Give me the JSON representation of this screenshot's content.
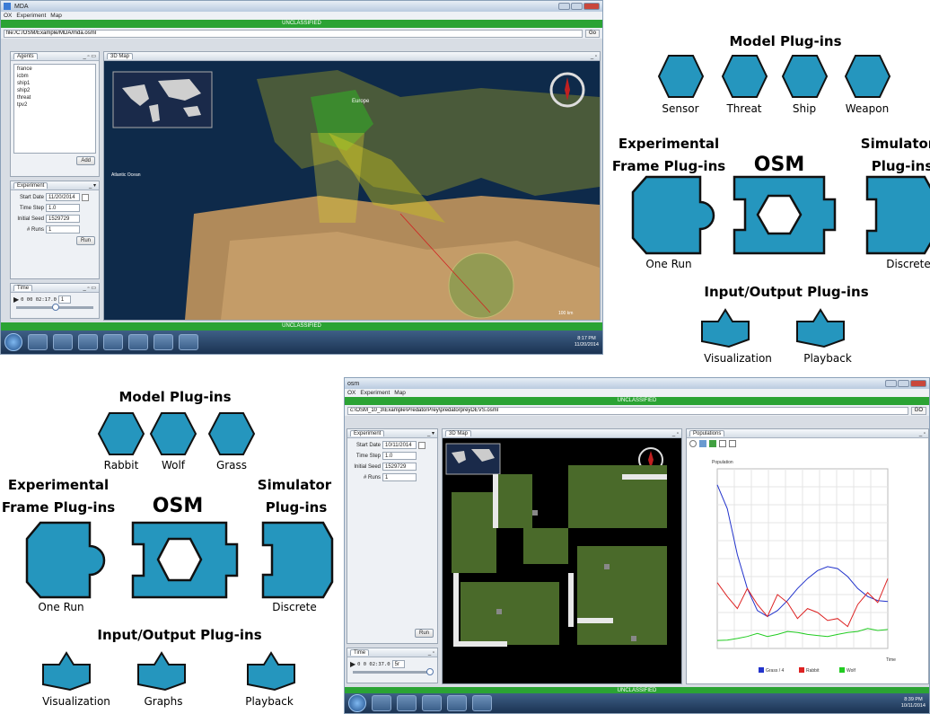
{
  "topleft_window": {
    "app_title": "MDA",
    "menu": [
      "OX",
      "Experiment",
      "Map"
    ],
    "banner_top": "UNCLASSIFIED",
    "banner_bottom": "UNCLASSIFIED",
    "url": "file:/C:/OSM/Example/MDA/mda.osml",
    "go_label": "Go",
    "agents_tab": "Agents",
    "agents": [
      "france",
      "icbm",
      "ship1",
      "ship2",
      "threat",
      "tpv2"
    ],
    "add_label": "Add",
    "experiment_tab": "Experiment",
    "start_date_label": "Start Date",
    "start_date": "11/20/2014",
    "time_step_label": "Time Step",
    "time_step": "1.0",
    "initial_seed_label": "Initial Seed",
    "initial_seed": "1529729",
    "runs_label": "# Runs",
    "runs": "1",
    "run_label": "Run",
    "time_tab": "Time",
    "time_value": "0 00 02:17.0",
    "time_speed": "1",
    "map_tab": "3D Map",
    "map_labels": {
      "europe": "Europe",
      "atlantic": "Atlantic Ocean",
      "scale": "100 km"
    },
    "clock_time": "8:17 PM",
    "clock_date": "11/20/2014"
  },
  "diagram_top": {
    "model_title": "Model Plug-ins",
    "model_plugins": [
      "Sensor",
      "Threat",
      "Ship",
      "Weapon"
    ],
    "ef_title_line1": "Experimental",
    "ef_title_line2": "Frame Plug-ins",
    "osm_title": "OSM",
    "sim_title_line1": "Simulator",
    "sim_title_line2": "Plug-ins",
    "ef_plugin": "One Run",
    "sim_plugin": "Discrete",
    "io_title": "Input/Output Plug-ins",
    "io_plugins": [
      "Visualization",
      "Playback"
    ]
  },
  "diagram_bottom": {
    "model_title": "Model Plug-ins",
    "model_plugins": [
      "Rabbit",
      "Wolf",
      "Grass"
    ],
    "ef_title_line1": "Experimental",
    "ef_title_line2": "Frame Plug-ins",
    "osm_title": "OSM",
    "sim_title_line1": "Simulator",
    "sim_title_line2": "Plug-ins",
    "ef_plugin": "One Run",
    "sim_plugin": "Discrete",
    "io_title": "Input/Output Plug-ins",
    "io_plugins": [
      "Visualization",
      "Graphs",
      "Playback"
    ]
  },
  "bottomright_window": {
    "app_title": "osm",
    "menu": [
      "OX",
      "Experiment",
      "Map"
    ],
    "banner_top": "UNCLASSIFIED",
    "banner_bottom": "UNCLASSIFIED",
    "url": "c:\\OSM_10_3\\Example\\PredatorPrey\\predatorpreyDEVS.osml",
    "go_label": "GO",
    "experiment_tab": "Experiment",
    "start_date_label": "Start Date",
    "start_date": "10/11/2014",
    "time_step_label": "Time Step",
    "time_step": "1.0",
    "initial_seed_label": "Initial Seed",
    "initial_seed": "1529729",
    "runs_label": "# Runs",
    "runs": "1",
    "run_label": "Run",
    "time_tab": "Time",
    "time_value": "0 0 02:37.0",
    "time_speed": "5r",
    "map_tab": "3D Map",
    "populations_tab": "Populations",
    "chart_ylabel": "Population",
    "chart_xlabel": "Time",
    "clock_time": "8:39 PM",
    "clock_date": "10/11/2014"
  },
  "chart_data": {
    "type": "line",
    "title": "",
    "ylabel": "Population",
    "xlabel": "Time",
    "legend": [
      "Grass / 4",
      "Rabbit",
      "Wolf"
    ],
    "colors": [
      "#2233cc",
      "#dd2222",
      "#22cc22"
    ],
    "series": [
      {
        "name": "Grass / 4",
        "values": [
          820,
          700,
          470,
          300,
          190,
          160,
          190,
          240,
          300,
          350,
          390,
          410,
          400,
          360,
          300,
          260,
          240,
          235
        ]
      },
      {
        "name": "Rabbit",
        "values": [
          330,
          260,
          200,
          300,
          220,
          160,
          270,
          230,
          150,
          200,
          180,
          140,
          150,
          110,
          220,
          280,
          230,
          350
        ]
      },
      {
        "name": "Wolf",
        "values": [
          40,
          42,
          50,
          60,
          75,
          60,
          70,
          85,
          80,
          70,
          65,
          60,
          70,
          80,
          85,
          100,
          90,
          95
        ]
      }
    ],
    "ylim": [
      0,
      900
    ]
  }
}
